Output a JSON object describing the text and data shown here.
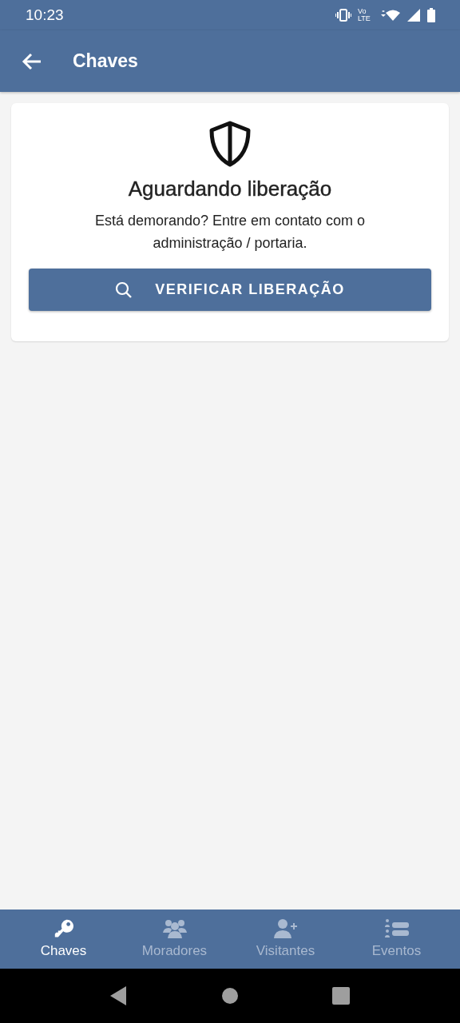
{
  "status_bar": {
    "time": "10:23",
    "network_top": "Vo",
    "network_bottom": "LTE"
  },
  "app_bar": {
    "title": "Chaves"
  },
  "card": {
    "title": "Aguardando liberação",
    "message": "Está demorando? Entre em contato com o administração / portaria.",
    "button": "VERIFICAR LIBERAÇÃO"
  },
  "bottom_nav": [
    {
      "kind": "key",
      "label": "Chaves",
      "selected": true
    },
    {
      "kind": "group",
      "label": "Moradores",
      "selected": false
    },
    {
      "kind": "add-person",
      "label": "Visitantes",
      "selected": false
    },
    {
      "kind": "list",
      "label": "Eventos",
      "selected": false
    }
  ]
}
